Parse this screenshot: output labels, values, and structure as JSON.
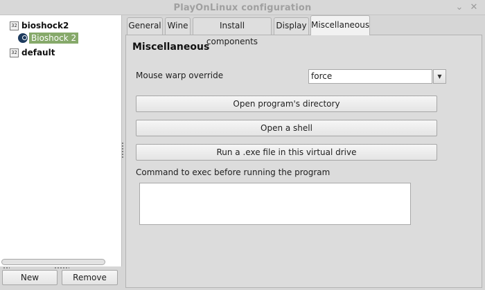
{
  "window": {
    "title": "PlayOnLinux configuration",
    "minimize_glyph": "⌄",
    "close_glyph": "✕"
  },
  "tree": {
    "items": [
      {
        "badge": "32",
        "label": "bioshock2",
        "icon": "badge-32-icon"
      },
      {
        "label": "Bioshock 2",
        "icon": "steam-icon",
        "selected": true
      },
      {
        "badge": "32",
        "label": "default",
        "icon": "badge-32-icon"
      }
    ]
  },
  "left_buttons": {
    "new_label": "New",
    "remove_label": "Remove"
  },
  "tabs": [
    {
      "label": "General"
    },
    {
      "label": "Wine"
    },
    {
      "label": "Install components"
    },
    {
      "label": "Display"
    },
    {
      "label": "Miscellaneous",
      "active": true
    }
  ],
  "misc": {
    "title": "Miscellaneous",
    "mouse_warp_label": "Mouse warp override",
    "mouse_warp_value": "force",
    "open_dir_label": "Open program's directory",
    "open_shell_label": "Open a shell",
    "run_exe_label": "Run a .exe file in this virtual drive",
    "command_label": "Command to exec before running the program",
    "command_value": ""
  }
}
